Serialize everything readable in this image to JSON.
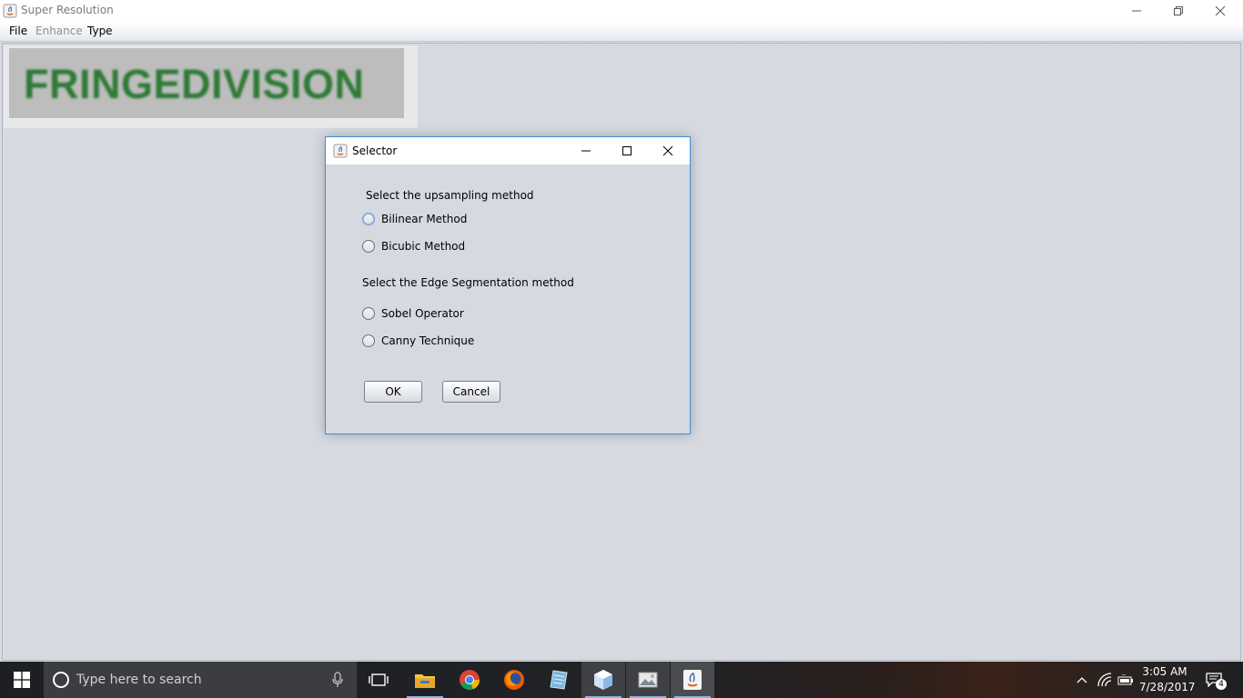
{
  "window": {
    "title": "Super Resolution",
    "menu": [
      {
        "label": "File",
        "enabled": true
      },
      {
        "label": "Enhance",
        "enabled": false
      },
      {
        "label": "Type",
        "enabled": true
      }
    ],
    "banner_text": "FRINGEDIVISION"
  },
  "dialog": {
    "title": "Selector",
    "upsampling_label": "Select the upsampling method",
    "upsampling_options": [
      "Bilinear Method",
      "Bicubic Method"
    ],
    "edge_label": "Select the Edge Segmentation method",
    "edge_options": [
      "Sobel Operator",
      "Canny Technique"
    ],
    "ok_label": "OK",
    "cancel_label": "Cancel"
  },
  "taskbar": {
    "search_placeholder": "Type here to search",
    "time": "3:05 AM",
    "date": "7/28/2017",
    "notification_count": "4",
    "apps": [
      "task-view",
      "file-explorer",
      "chrome",
      "firefox",
      "notepad",
      "box-app",
      "photos",
      "java"
    ]
  },
  "colors": {
    "accent": "#3d8fd6",
    "banner_text": "#2f7a36",
    "background": "#d6d9e0"
  }
}
